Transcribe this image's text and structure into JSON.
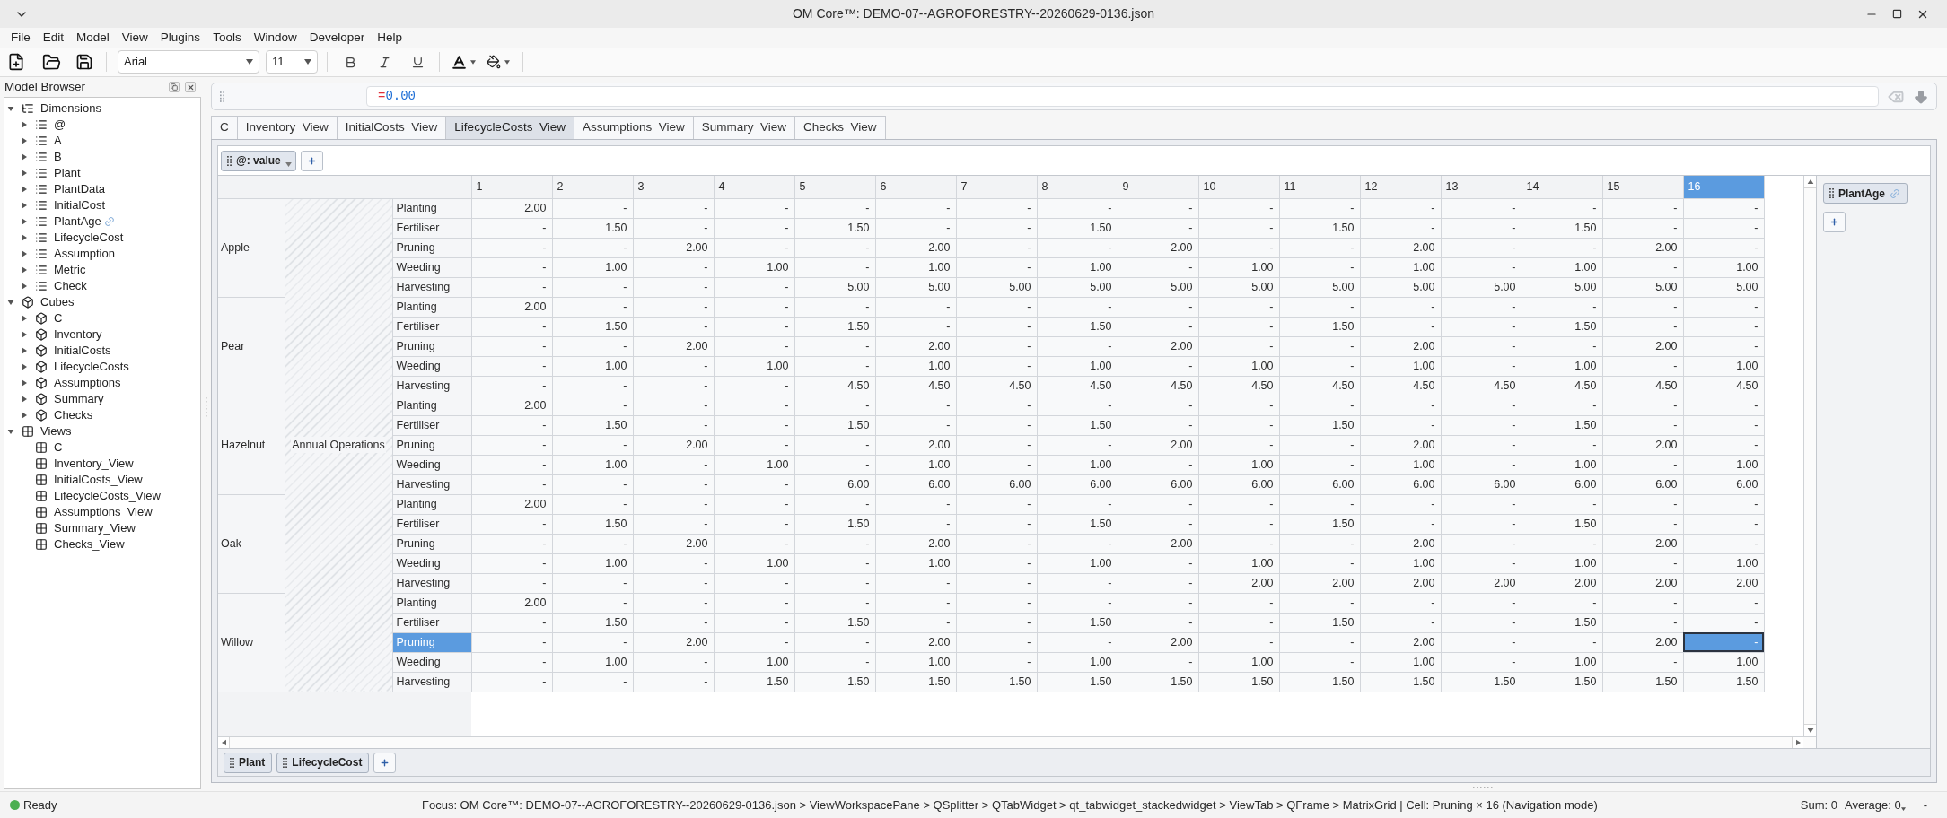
{
  "window": {
    "title": "OM Core™: DEMO-07--AGROFORESTRY--20260629-0136.json"
  },
  "menu": [
    "File",
    "Edit",
    "Model",
    "View",
    "Plugins",
    "Tools",
    "Window",
    "Developer",
    "Help"
  ],
  "toolbar": {
    "font": "Arial",
    "size": "11"
  },
  "model_browser": {
    "title": "Model Browser",
    "tree": [
      {
        "label": "Dimensions",
        "kind": "dimensions",
        "expanded": true,
        "children": [
          {
            "label": "@",
            "kind": "dimension",
            "expanded": false,
            "linked": false
          },
          {
            "label": "A",
            "kind": "dimension",
            "expanded": false,
            "linked": false
          },
          {
            "label": "B",
            "kind": "dimension",
            "expanded": false,
            "linked": false
          },
          {
            "label": "Plant",
            "kind": "dimension",
            "expanded": false,
            "linked": false
          },
          {
            "label": "PlantData",
            "kind": "dimension",
            "expanded": false,
            "linked": false
          },
          {
            "label": "InitialCost",
            "kind": "dimension",
            "expanded": false,
            "linked": false
          },
          {
            "label": "PlantAge",
            "kind": "dimension",
            "expanded": false,
            "linked": true
          },
          {
            "label": "LifecycleCost",
            "kind": "dimension",
            "expanded": false,
            "linked": false
          },
          {
            "label": "Assumption",
            "kind": "dimension",
            "expanded": false,
            "linked": false
          },
          {
            "label": "Metric",
            "kind": "dimension",
            "expanded": false,
            "linked": false
          },
          {
            "label": "Check",
            "kind": "dimension",
            "expanded": false,
            "linked": false
          }
        ]
      },
      {
        "label": "Cubes",
        "kind": "cubes",
        "expanded": true,
        "children": [
          {
            "label": "C",
            "kind": "cube",
            "expanded": false
          },
          {
            "label": "Inventory",
            "kind": "cube",
            "expanded": false
          },
          {
            "label": "InitialCosts",
            "kind": "cube",
            "expanded": false
          },
          {
            "label": "LifecycleCosts",
            "kind": "cube",
            "expanded": false
          },
          {
            "label": "Assumptions",
            "kind": "cube",
            "expanded": false
          },
          {
            "label": "Summary",
            "kind": "cube",
            "expanded": false
          },
          {
            "label": "Checks",
            "kind": "cube",
            "expanded": false
          }
        ]
      },
      {
        "label": "Views",
        "kind": "views",
        "expanded": true,
        "children": [
          {
            "label": "C",
            "kind": "view"
          },
          {
            "label": "Inventory_View",
            "kind": "view"
          },
          {
            "label": "InitialCosts_View",
            "kind": "view"
          },
          {
            "label": "LifecycleCosts_View",
            "kind": "view"
          },
          {
            "label": "Assumptions_View",
            "kind": "view"
          },
          {
            "label": "Summary_View",
            "kind": "view"
          },
          {
            "label": "Checks_View",
            "kind": "view"
          }
        ]
      }
    ]
  },
  "formula_bar": {
    "operator": "=",
    "value": "0.00"
  },
  "tabs": [
    {
      "label": "C",
      "selected": false
    },
    {
      "label": "Inventory  View",
      "selected": false
    },
    {
      "label": "InitialCosts  View",
      "selected": false
    },
    {
      "label": "LifecycleCosts  View",
      "selected": true
    },
    {
      "label": "Assumptions  View",
      "selected": false
    },
    {
      "label": "Summary  View",
      "selected": false
    },
    {
      "label": "Checks  View",
      "selected": false
    }
  ],
  "grid": {
    "filter_pills": [
      {
        "label": "@: value"
      }
    ],
    "page_pills": [
      {
        "label": "PlantAge",
        "linked": true
      }
    ],
    "row_pills": [
      {
        "label": "Plant"
      },
      {
        "label": "LifecycleCost"
      }
    ],
    "section_label": "Annual Operations",
    "columns": [
      {
        "label": "1",
        "selected": false
      },
      {
        "label": "2",
        "selected": false
      },
      {
        "label": "3",
        "selected": false
      },
      {
        "label": "4",
        "selected": false
      },
      {
        "label": "5",
        "selected": false
      },
      {
        "label": "6",
        "selected": false
      },
      {
        "label": "7",
        "selected": false
      },
      {
        "label": "8",
        "selected": false
      },
      {
        "label": "9",
        "selected": false
      },
      {
        "label": "10",
        "selected": false
      },
      {
        "label": "11",
        "selected": false
      },
      {
        "label": "12",
        "selected": false
      },
      {
        "label": "13",
        "selected": false
      },
      {
        "label": "14",
        "selected": false
      },
      {
        "label": "15",
        "selected": false
      },
      {
        "label": "16",
        "selected": true
      }
    ],
    "groups": [
      {
        "label": "Apple",
        "rows": [
          {
            "label": "Planting",
            "selected": false,
            "cells": [
              "2.00",
              "-",
              "-",
              "-",
              "-",
              "-",
              "-",
              "-",
              "-",
              "-",
              "-",
              "-",
              "-",
              "-",
              "-",
              "-"
            ]
          },
          {
            "label": "Fertiliser",
            "selected": false,
            "cells": [
              "-",
              "1.50",
              "-",
              "-",
              "1.50",
              "-",
              "-",
              "1.50",
              "-",
              "-",
              "1.50",
              "-",
              "-",
              "1.50",
              "-",
              "-"
            ]
          },
          {
            "label": "Pruning",
            "selected": false,
            "cells": [
              "-",
              "-",
              "2.00",
              "-",
              "-",
              "2.00",
              "-",
              "-",
              "2.00",
              "-",
              "-",
              "2.00",
              "-",
              "-",
              "2.00",
              "-"
            ]
          },
          {
            "label": "Weeding",
            "selected": false,
            "cells": [
              "-",
              "1.00",
              "-",
              "1.00",
              "-",
              "1.00",
              "-",
              "1.00",
              "-",
              "1.00",
              "-",
              "1.00",
              "-",
              "1.00",
              "-",
              "1.00"
            ]
          },
          {
            "label": "Harvesting",
            "selected": false,
            "cells": [
              "-",
              "-",
              "-",
              "-",
              "5.00",
              "5.00",
              "5.00",
              "5.00",
              "5.00",
              "5.00",
              "5.00",
              "5.00",
              "5.00",
              "5.00",
              "5.00",
              "5.00"
            ]
          }
        ]
      },
      {
        "label": "Pear",
        "rows": [
          {
            "label": "Planting",
            "selected": false,
            "cells": [
              "2.00",
              "-",
              "-",
              "-",
              "-",
              "-",
              "-",
              "-",
              "-",
              "-",
              "-",
              "-",
              "-",
              "-",
              "-",
              "-"
            ]
          },
          {
            "label": "Fertiliser",
            "selected": false,
            "cells": [
              "-",
              "1.50",
              "-",
              "-",
              "1.50",
              "-",
              "-",
              "1.50",
              "-",
              "-",
              "1.50",
              "-",
              "-",
              "1.50",
              "-",
              "-"
            ]
          },
          {
            "label": "Pruning",
            "selected": false,
            "cells": [
              "-",
              "-",
              "2.00",
              "-",
              "-",
              "2.00",
              "-",
              "-",
              "2.00",
              "-",
              "-",
              "2.00",
              "-",
              "-",
              "2.00",
              "-"
            ]
          },
          {
            "label": "Weeding",
            "selected": false,
            "cells": [
              "-",
              "1.00",
              "-",
              "1.00",
              "-",
              "1.00",
              "-",
              "1.00",
              "-",
              "1.00",
              "-",
              "1.00",
              "-",
              "1.00",
              "-",
              "1.00"
            ]
          },
          {
            "label": "Harvesting",
            "selected": false,
            "cells": [
              "-",
              "-",
              "-",
              "-",
              "4.50",
              "4.50",
              "4.50",
              "4.50",
              "4.50",
              "4.50",
              "4.50",
              "4.50",
              "4.50",
              "4.50",
              "4.50",
              "4.50"
            ]
          }
        ]
      },
      {
        "label": "Hazelnut",
        "rows": [
          {
            "label": "Planting",
            "selected": false,
            "cells": [
              "2.00",
              "-",
              "-",
              "-",
              "-",
              "-",
              "-",
              "-",
              "-",
              "-",
              "-",
              "-",
              "-",
              "-",
              "-",
              "-"
            ]
          },
          {
            "label": "Fertiliser",
            "selected": false,
            "cells": [
              "-",
              "1.50",
              "-",
              "-",
              "1.50",
              "-",
              "-",
              "1.50",
              "-",
              "-",
              "1.50",
              "-",
              "-",
              "1.50",
              "-",
              "-"
            ]
          },
          {
            "label": "Pruning",
            "selected": false,
            "cells": [
              "-",
              "-",
              "2.00",
              "-",
              "-",
              "2.00",
              "-",
              "-",
              "2.00",
              "-",
              "-",
              "2.00",
              "-",
              "-",
              "2.00",
              "-"
            ]
          },
          {
            "label": "Weeding",
            "selected": false,
            "cells": [
              "-",
              "1.00",
              "-",
              "1.00",
              "-",
              "1.00",
              "-",
              "1.00",
              "-",
              "1.00",
              "-",
              "1.00",
              "-",
              "1.00",
              "-",
              "1.00"
            ]
          },
          {
            "label": "Harvesting",
            "selected": false,
            "cells": [
              "-",
              "-",
              "-",
              "-",
              "6.00",
              "6.00",
              "6.00",
              "6.00",
              "6.00",
              "6.00",
              "6.00",
              "6.00",
              "6.00",
              "6.00",
              "6.00",
              "6.00"
            ]
          }
        ]
      },
      {
        "label": "Oak",
        "rows": [
          {
            "label": "Planting",
            "selected": false,
            "cells": [
              "2.00",
              "-",
              "-",
              "-",
              "-",
              "-",
              "-",
              "-",
              "-",
              "-",
              "-",
              "-",
              "-",
              "-",
              "-",
              "-"
            ]
          },
          {
            "label": "Fertiliser",
            "selected": false,
            "cells": [
              "-",
              "1.50",
              "-",
              "-",
              "1.50",
              "-",
              "-",
              "1.50",
              "-",
              "-",
              "1.50",
              "-",
              "-",
              "1.50",
              "-",
              "-"
            ]
          },
          {
            "label": "Pruning",
            "selected": false,
            "cells": [
              "-",
              "-",
              "2.00",
              "-",
              "-",
              "2.00",
              "-",
              "-",
              "2.00",
              "-",
              "-",
              "2.00",
              "-",
              "-",
              "2.00",
              "-"
            ]
          },
          {
            "label": "Weeding",
            "selected": false,
            "cells": [
              "-",
              "1.00",
              "-",
              "1.00",
              "-",
              "1.00",
              "-",
              "1.00",
              "-",
              "1.00",
              "-",
              "1.00",
              "-",
              "1.00",
              "-",
              "1.00"
            ]
          },
          {
            "label": "Harvesting",
            "selected": false,
            "cells": [
              "-",
              "-",
              "-",
              "-",
              "-",
              "-",
              "-",
              "-",
              "-",
              "2.00",
              "2.00",
              "2.00",
              "2.00",
              "2.00",
              "2.00",
              "2.00"
            ]
          }
        ]
      },
      {
        "label": "Willow",
        "rows": [
          {
            "label": "Planting",
            "selected": false,
            "cells": [
              "2.00",
              "-",
              "-",
              "-",
              "-",
              "-",
              "-",
              "-",
              "-",
              "-",
              "-",
              "-",
              "-",
              "-",
              "-",
              "-"
            ]
          },
          {
            "label": "Fertiliser",
            "selected": false,
            "cells": [
              "-",
              "1.50",
              "-",
              "-",
              "1.50",
              "-",
              "-",
              "1.50",
              "-",
              "-",
              "1.50",
              "-",
              "-",
              "1.50",
              "-",
              "-"
            ]
          },
          {
            "label": "Pruning",
            "selected": true,
            "cells": [
              "-",
              "-",
              "2.00",
              "-",
              "-",
              "2.00",
              "-",
              "-",
              "2.00",
              "-",
              "-",
              "2.00",
              "-",
              "-",
              "2.00",
              "-"
            ]
          },
          {
            "label": "Weeding",
            "selected": false,
            "cells": [
              "-",
              "1.00",
              "-",
              "1.00",
              "-",
              "1.00",
              "-",
              "1.00",
              "-",
              "1.00",
              "-",
              "1.00",
              "-",
              "1.00",
              "-",
              "1.00"
            ]
          },
          {
            "label": "Harvesting",
            "selected": false,
            "cells": [
              "-",
              "-",
              "-",
              "1.50",
              "1.50",
              "1.50",
              "1.50",
              "1.50",
              "1.50",
              "1.50",
              "1.50",
              "1.50",
              "1.50",
              "1.50",
              "1.50",
              "1.50"
            ]
          }
        ]
      }
    ]
  },
  "status_bar": {
    "state": "Ready",
    "focus": "Focus: OM Core™: DEMO-07--AGROFORESTRY--20260629-0136.json > ViewWorkspacePane > QSplitter > QTabWidget > qt_tabwidget_stackedwidget > ViewTab > QFrame > MatrixGrid | Cell: Pruning × 16 (Navigation mode)",
    "sum": "Sum: 0",
    "average": "Average: 0",
    "extra": "-"
  }
}
